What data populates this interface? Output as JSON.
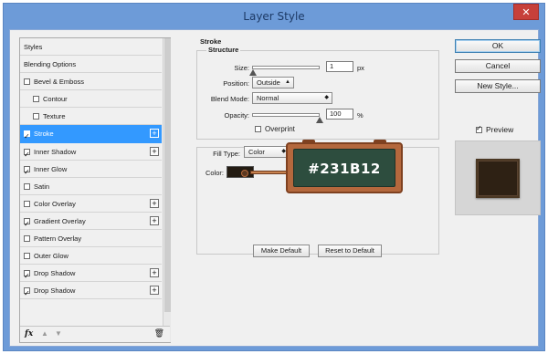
{
  "window": {
    "title": "Layer Style",
    "close_label": "x"
  },
  "styles_panel": {
    "items": [
      {
        "label": "Styles",
        "checkbox": false,
        "checked": false,
        "plus": false,
        "indent": false,
        "selected": false
      },
      {
        "label": "Blending Options",
        "checkbox": false,
        "checked": false,
        "plus": false,
        "indent": false,
        "selected": false
      },
      {
        "label": "Bevel & Emboss",
        "checkbox": true,
        "checked": false,
        "plus": false,
        "indent": false,
        "selected": false
      },
      {
        "label": "Contour",
        "checkbox": true,
        "checked": false,
        "plus": false,
        "indent": true,
        "selected": false
      },
      {
        "label": "Texture",
        "checkbox": true,
        "checked": false,
        "plus": false,
        "indent": true,
        "selected": false
      },
      {
        "label": "Stroke",
        "checkbox": true,
        "checked": true,
        "plus": true,
        "indent": false,
        "selected": true
      },
      {
        "label": "Inner Shadow",
        "checkbox": true,
        "checked": true,
        "plus": true,
        "indent": false,
        "selected": false
      },
      {
        "label": "Inner Glow",
        "checkbox": true,
        "checked": true,
        "plus": false,
        "indent": false,
        "selected": false
      },
      {
        "label": "Satin",
        "checkbox": true,
        "checked": false,
        "plus": false,
        "indent": false,
        "selected": false
      },
      {
        "label": "Color Overlay",
        "checkbox": true,
        "checked": false,
        "plus": true,
        "indent": false,
        "selected": false
      },
      {
        "label": "Gradient Overlay",
        "checkbox": true,
        "checked": true,
        "plus": true,
        "indent": false,
        "selected": false
      },
      {
        "label": "Pattern Overlay",
        "checkbox": true,
        "checked": false,
        "plus": false,
        "indent": false,
        "selected": false
      },
      {
        "label": "Outer Glow",
        "checkbox": true,
        "checked": false,
        "plus": false,
        "indent": false,
        "selected": false
      },
      {
        "label": "Drop Shadow",
        "checkbox": true,
        "checked": true,
        "plus": true,
        "indent": false,
        "selected": false
      },
      {
        "label": "Drop Shadow",
        "checkbox": true,
        "checked": true,
        "plus": true,
        "indent": false,
        "selected": false
      }
    ],
    "footer": {
      "fx_label": "fx",
      "up_icon": "arrow-up-icon",
      "down_icon": "arrow-down-icon",
      "trash_icon": "trash-icon"
    }
  },
  "stroke": {
    "section_title": "Stroke",
    "structure_title": "Structure",
    "size_label": "Size:",
    "size_value": "1",
    "size_unit": "px",
    "size_slider_fraction": 0.0,
    "position_label": "Position:",
    "position_value": "Outside",
    "blend_mode_label": "Blend Mode:",
    "blend_mode_value": "Normal",
    "opacity_label": "Opacity:",
    "opacity_value": "100",
    "opacity_unit": "%",
    "opacity_slider_fraction": 1.0,
    "overprint_label": "Overprint",
    "overprint_checked": false,
    "fill_type_label": "Fill Type:",
    "fill_type_value": "Color",
    "color_label": "Color:",
    "color_hex": "#231b12",
    "color_callout": "#231B12",
    "make_default_label": "Make Default",
    "reset_default_label": "Reset to Default"
  },
  "actions": {
    "ok_label": "OK",
    "cancel_label": "Cancel",
    "new_style_label": "New Style...",
    "preview_label": "Preview",
    "preview_checked": true
  },
  "colors": {
    "selected": "#3399ff",
    "titlebar": "#6d9bd8",
    "swatch": "#231b12"
  }
}
